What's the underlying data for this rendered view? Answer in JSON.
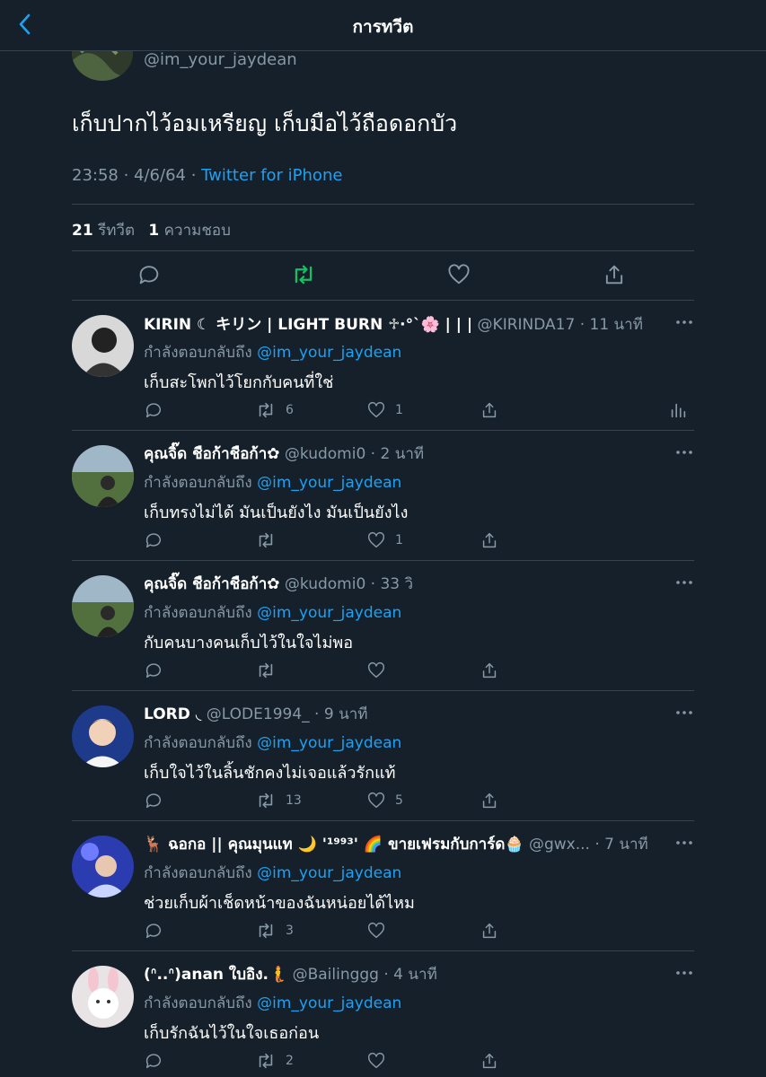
{
  "header": {
    "title": "การทวีต"
  },
  "tweet": {
    "handle": "@im_your_jaydean",
    "text": "เก็บปากไว้อมเหรียญ เก็บมือไว้ถือดอกบัว",
    "time": "23:58 · 4/6/64 · ",
    "source": "Twitter for iPhone",
    "retweets_count": "21",
    "retweets_label": "รีทวีต",
    "likes_count": "1",
    "likes_label": "ความชอบ"
  },
  "replying_prefix": "กำลังตอบกลับถึง",
  "replies": [
    {
      "name": "KIRIN ☾ キリン | LIGHT BURN ♱·°`🌸 | | |",
      "handle": "@KIRINDA17 · 11 นาที",
      "mention": "@im_your_jaydean",
      "text": "เก็บสะโพกไว้โยกกับคนที่ใช่",
      "retweets": "6",
      "likes": "1"
    },
    {
      "name": "คุณจิ๊ด ชือก้าชือก้า✿",
      "handle": "@kudomi0 · 2 นาที",
      "mention": "@im_your_jaydean",
      "text": "เก็บทรงไม่ได้ มันเป็นยังไง มันเป็นยังไง",
      "retweets": "",
      "likes": "1"
    },
    {
      "name": "คุณจิ๊ด ชือก้าชือก้า✿",
      "handle": "@kudomi0 · 33 วิ",
      "mention": "@im_your_jaydean",
      "text": "กับคนบางคนเก็บไว้ในใจไม่พอ",
      "retweets": "",
      "likes": ""
    },
    {
      "name": "LORD ◟",
      "handle": "@LODE1994_ · 9 นาที",
      "mention": "@im_your_jaydean",
      "text": "เก็บใจไว้ในลิ้นชักคงไม่เจอแล้วรักแท้",
      "retweets": "13",
      "likes": "5"
    },
    {
      "name": "🦌 ฉอกอ || คุณมุนแท 🌙 '¹⁹⁹³' 🌈 ขายเฟรมกับการ์ด🧁",
      "handle": "@gwx... · 7 นาที",
      "mention": "@im_your_jaydean",
      "text": "ช่วยเก็บผ้าเช็ดหน้าของฉันหน่อยได้ไหม",
      "retweets": "3",
      "likes": ""
    },
    {
      "name": "(ᐢ..ᐢ)anan ใบอิง.🧜",
      "handle": "@Bailinggg · 4 นาที",
      "mention": "@im_your_jaydean",
      "text": "เก็บรักฉันไว้ในใจเธอก่อน",
      "retweets": "2",
      "likes": ""
    }
  ],
  "colors": {
    "background": "#15202b",
    "accent": "#1da1f2",
    "retweet_green": "#17bf63",
    "secondary_text": "#8899a6",
    "divider": "#38444d"
  }
}
